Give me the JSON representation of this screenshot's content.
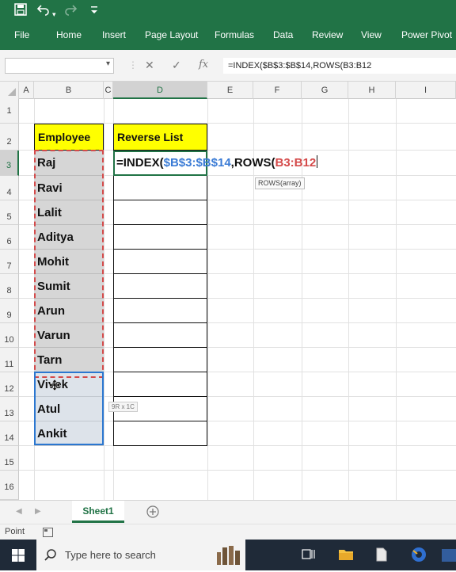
{
  "qat": {
    "save_icon": "save-icon",
    "undo_icon": "undo-icon",
    "redo_icon": "redo-icon",
    "customize_icon": "chevron-down-icon"
  },
  "ribbon": {
    "tabs": [
      "File",
      "Home",
      "Insert",
      "Page Layout",
      "Formulas",
      "Data",
      "Review",
      "View",
      "Power Pivot"
    ]
  },
  "formula_bar": {
    "name_box": "",
    "cancel_glyph": "✕",
    "enter_glyph": "✓",
    "fx_label": "fx",
    "formula": "=INDEX($B$3:$B$14,ROWS(B3:B12"
  },
  "grid": {
    "columns": [
      "A",
      "B",
      "C",
      "D",
      "E",
      "F",
      "G",
      "H",
      "I"
    ],
    "rows": [
      "1",
      "2",
      "3",
      "4",
      "5",
      "6",
      "7",
      "8",
      "9",
      "10",
      "11",
      "12",
      "13",
      "14",
      "15",
      "16"
    ],
    "header_employee": "Employee",
    "header_reverse": "Reverse List",
    "employees": [
      "Raj",
      "Ravi",
      "Lalit",
      "Aditya",
      "Mohit",
      "Sumit",
      "Arun",
      "Varun",
      "Tarn",
      "Vivek",
      "Atul",
      "Ankit"
    ],
    "edit_formula": {
      "eq": "=INDEX(",
      "ref1": "$B$3:$B$14",
      "mid": ",ROWS(",
      "ref2": "B3:B12"
    },
    "tooltip": "ROWS(array)",
    "size_hint": "9R x 1C"
  },
  "sheets": {
    "active": "Sheet1",
    "add_icon": "plus-circle-icon"
  },
  "status": {
    "mode": "Point"
  },
  "taskbar": {
    "search_placeholder": "Type here to search"
  },
  "colors": {
    "excel_green": "#217346",
    "header_yellow": "#ffff00",
    "ref_blue": "#3a7bd5",
    "ref_red": "#d44a4a"
  }
}
